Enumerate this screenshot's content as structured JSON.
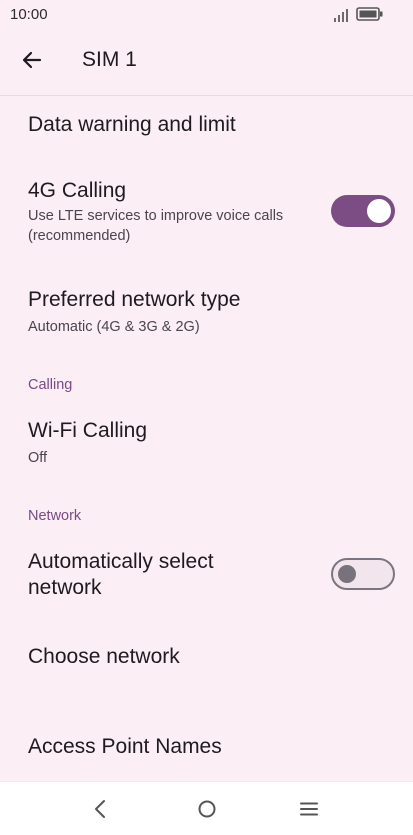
{
  "status_bar": {
    "time": "10:00"
  },
  "header": {
    "title": "SIM 1"
  },
  "items": {
    "data_warning": {
      "title": "Data warning and limit"
    },
    "calling_4g": {
      "title": "4G Calling",
      "subtitle_line1": "Use LTE services to improve voice calls",
      "subtitle_line2": "(recommended)",
      "enabled": true
    },
    "preferred_network": {
      "title": "Preferred network type",
      "subtitle": "Automatic (4G & 3G & 2G)"
    },
    "wifi_calling": {
      "title": "Wi-Fi Calling",
      "subtitle": "Off"
    },
    "auto_select": {
      "title_line1": "Automatically select",
      "title_line2": "network",
      "enabled": false
    },
    "choose_network": {
      "title": "Choose network"
    },
    "apn": {
      "title": "Access Point Names"
    }
  },
  "sections": {
    "calling": "Calling",
    "network": "Network"
  },
  "colors": {
    "accent": "#7b4d84",
    "background": "#fbeef4",
    "section_header": "#7a4a87"
  }
}
